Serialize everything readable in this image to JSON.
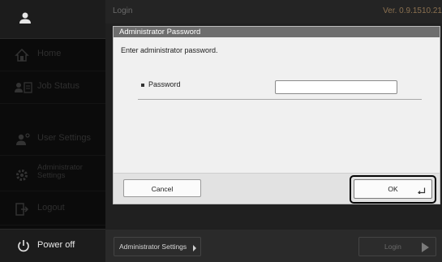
{
  "header": {
    "title": "Login",
    "version": "Ver. 0.9.1510.21"
  },
  "sidebar": {
    "user_icon": "user-icon",
    "items": [
      {
        "label": "Home",
        "icon": "home-icon"
      },
      {
        "label": "Job Status",
        "icon": "job-status-icon"
      },
      {
        "label": "User Settings",
        "icon": "user-settings-icon"
      },
      {
        "label": "Administrator Settings",
        "icon": "gear-icon"
      },
      {
        "label": "Logout",
        "icon": "logout-icon"
      }
    ],
    "power": {
      "label": "Power off",
      "icon": "power-icon"
    }
  },
  "dialog": {
    "title": "Administrator Password",
    "message": "Enter administrator password.",
    "password_label": "Password",
    "password_value": "",
    "cancel_label": "Cancel",
    "ok_label": "OK"
  },
  "bottombar": {
    "admin_settings_label": "Administrator Settings",
    "login_label": "Login"
  },
  "colors": {
    "sidebar_bg": "#0b0b0b",
    "dialog_title_bg": "#6e6e6e",
    "highlight_ring": "#050505"
  }
}
